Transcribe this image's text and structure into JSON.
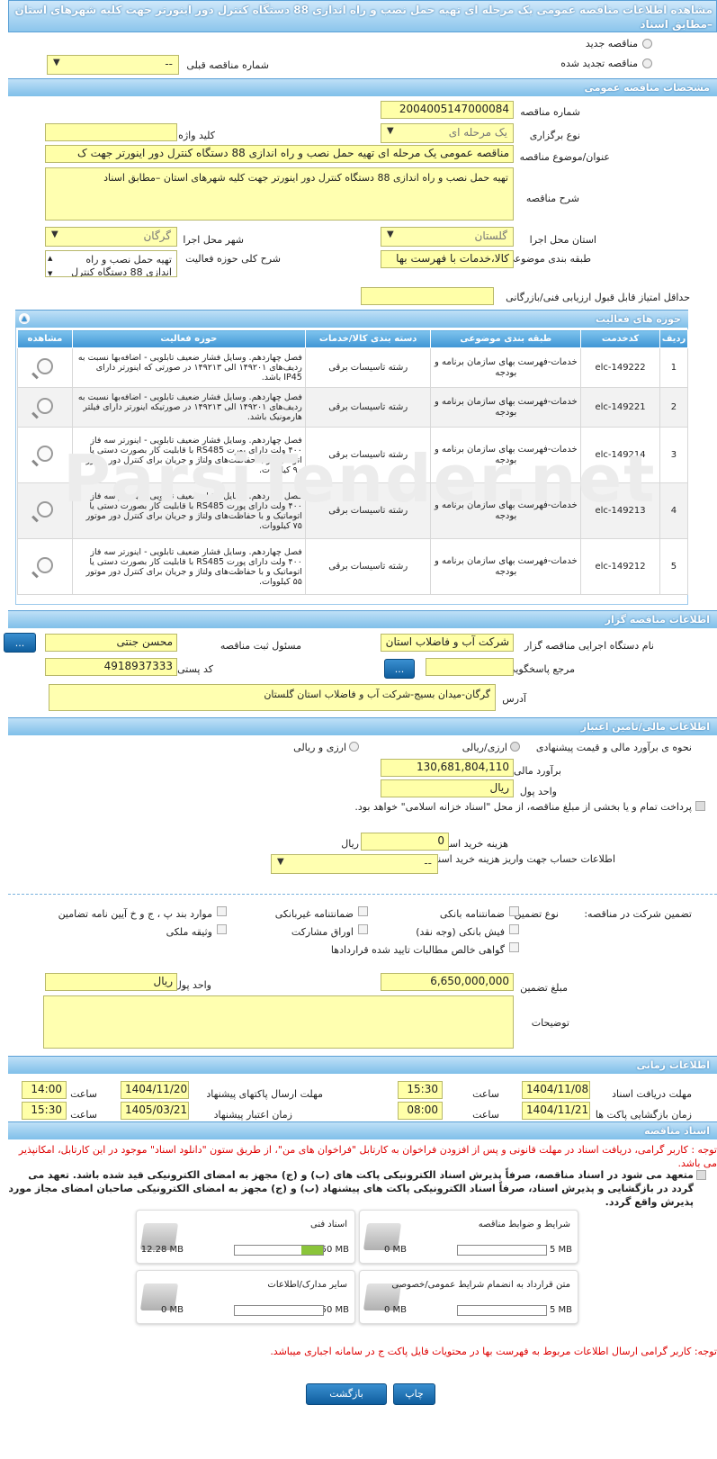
{
  "title": "مشاهده اطلاعات مناقصه عمومی یک مرحله ای تهیه حمل نصب و راه اندازی 88 دستگاه کنترل دور اینورتر جهت کلیه شهرهای استان –مطابق اسناد",
  "type_new": "مناقصه جدید",
  "type_renew": "مناقصه تجدید شده",
  "prev_label": "شماره مناقصه قبلی",
  "prev_value": "--",
  "sec_general": "مشخصات مناقصه عمومی",
  "tender_no_label": "شماره مناقصه",
  "tender_no": "2004005147000084",
  "hold_type_label": "نوع برگزاری",
  "hold_type": "یک مرحله ای",
  "keyword_label": "کلید واژه",
  "subject_label": "عنوان/موضوع مناقصه",
  "subject": "مناقصه عمومی یک مرحله ای تهیه حمل نصب و راه اندازی 88 دستگاه کنترل دور اینورتر جهت ک",
  "desc_label": "شرح مناقصه",
  "desc": "تهیه حمل نصب و راه اندازی 88 دستگاه کنترل دور اینورتر جهت کلیه شهرهای استان –مطابق اسناد",
  "province_label": "استان محل اجرا",
  "province": "گلستان",
  "city_label": "شهر محل اجرا",
  "city": "گرگان",
  "class_label": "طبقه بندی موضوعی",
  "class_value": "کالا،خدمات با فهرست بها",
  "activity_desc_label": "شرح کلی حوزه فعالیت",
  "activity_desc": "تهیه حمل نصب و راه اندازی 88 دستگاه کنترل",
  "min_score_label": "حداقل امتیاز قابل قبول ارزیابی فنی/بازرگانی",
  "sec_activity": "حوزه های فعالیت",
  "table_headers": [
    "ردیف",
    "کدخدمت",
    "طبقه بندی موضوعی",
    "دسته بندی کالا/خدمات",
    "حوزه فعالیت",
    "مشاهده"
  ],
  "table_rows": [
    {
      "no": "1",
      "code": "elc-149222",
      "class": "خدمات-فهرست بهای سازمان برنامه و بودجه",
      "cat": "رشته تاسیسات برقی",
      "act": "فصل چهاردهم. وسایل فشار ضعیف تابلویی - اضافه‌بها نسبت به ردیف‌های ۱۴۹۲۰۱ الی ۱۴۹۲۱۳ در صورتی که اینورتر دارای IP45 باشد."
    },
    {
      "no": "2",
      "code": "elc-149221",
      "class": "خدمات-فهرست بهای سازمان برنامه و بودجه",
      "cat": "رشته تاسیسات برقی",
      "act": "فصل چهاردهم. وسایل فشار ضعیف تابلویی - اضافه‌بها نسبت به ردیف‌های ۱۴۹۲۰۱ الی ۱۴۹۲۱۳ در صورتیکه اینورتر دارای فیلتر هارمونیک باشد."
    },
    {
      "no": "3",
      "code": "elc-149214",
      "class": "خدمات-فهرست بهای سازمان برنامه و بودجه",
      "cat": "رشته تاسیسات برقی",
      "act": "فصل چهاردهم. وسایل فشار ضعیف تابلویی - اینورتر سه فاز ۴۰۰ ولت دارای پورت RS485 با قابلیت کار بصورت دستی یا اتوماتیک و با حفاظت‌های ولتاژ و جریان برای کنترل دور موتور ۹۰ کیلووات."
    },
    {
      "no": "4",
      "code": "elc-149213",
      "class": "خدمات-فهرست بهای سازمان برنامه و بودجه",
      "cat": "رشته تاسیسات برقی",
      "act": "فصل چهاردهم. وسایل فشار ضعیف تابلویی - اینورتر سه فاز ۴۰۰ ولت دارای پورت RS485 با قابلیت کار بصورت دستی یا اتوماتیک و با حفاظت‌های ولتاژ و جریان برای کنترل دور موتور ۷۵ کیلووات."
    },
    {
      "no": "5",
      "code": "elc-149212",
      "class": "خدمات-فهرست بهای سازمان برنامه و بودجه",
      "cat": "رشته تاسیسات برقی",
      "act": "فصل چهاردهم. وسایل فشار ضعیف تابلویی - اینورتر سه فاز ۴۰۰ ولت دارای پورت RS485 با قابلیت کار بصورت دستی یا اتوماتیک و با حفاظت‌های ولتاژ و جریان برای کنترل دور موتور ۵۵ کیلووات."
    }
  ],
  "watermark": "ParsiTender.net",
  "sec_organizer": "اطلاعات مناقصه گزار",
  "org_label": "نام دستگاه اجرایی مناقصه گزار",
  "org": "شرکت آب و فاضلاب استان",
  "resp_label": "مسئول ثبت مناقصه",
  "resp": "محسن جنتی",
  "ref_label": "مرجع پاسخگویی",
  "postal_label": "کد پستی",
  "postal": "4918937333",
  "address_label": "آدرس",
  "address": "گرگان-میدان بسیج-شرکت آب و فاضلاب استان گلستان",
  "dots": "...",
  "sec_finance": "اطلاعات مالی/تامین اعتبار",
  "estimate_type_label": "نحوه ی برآورد مالی و قیمت پیشنهادی",
  "opt_rial": "ارزی/ریالی",
  "opt_both": "ارزی و ریالی",
  "estimate_label": "برآورد مالی",
  "estimate": "130,681,804,110",
  "currency_label": "واحد پول",
  "currency": "ریال",
  "treasury_text": "پرداخت تمام و یا بخشی از مبلغ مناقصه، از محل \"اسناد خزانه اسلامی\" خواهد بود.",
  "doc_cost_label": "هزینه خرید اسناد",
  "doc_cost": "0",
  "doc_cost_unit": "ریال",
  "account_label": "اطلاعات حساب جهت واریز هزینه خرید اسناد",
  "account_value": "--",
  "guarantee_label": "تضمین شرکت در مناقصه:",
  "guarantee_type_label": "نوع تضمین",
  "g1": "ضمانتنامه بانکی",
  "g2": "ضمانتنامه غیربانکی",
  "g3": "موارد بند پ ، ج و خ آیین نامه تضامین",
  "g4": "فیش بانکی (وجه نقد)",
  "g5": "اوراق مشارکت",
  "g6": "وثیقه ملکی",
  "g7": "گواهی خالص مطالبات تایید شده قراردادها",
  "guarantee_amount_label": "مبلغ تضمین",
  "guarantee_amount": "6,650,000,000",
  "g_currency_label": "واحد پول",
  "g_currency": "ریال",
  "notes_label": "توضیحات",
  "sec_time": "اطلاعات زمانی",
  "doc_deadline_label": "مهلت دریافت اسناد",
  "doc_deadline": "1404/11/08",
  "time_label": "ساعت",
  "doc_deadline_time": "15:30",
  "send_deadline_label": "مهلت ارسال پاکتهای پیشنهاد",
  "send_deadline": "1404/11/20",
  "send_deadline_time": "14:00",
  "open_label": "زمان بازگشایی پاکت ها",
  "open_date": "1404/11/21",
  "open_time": "08:00",
  "valid_label": "زمان اعتبار پیشنهاد",
  "valid_date": "1405/03/21",
  "valid_time": "15:30",
  "sec_docs": "اسناد مناقصه",
  "notice1": "توجه : کاربر گرامی، دریافت اسناد در مهلت قانونی و پس از افزودن فراخوان به کارتابل \"فراخوان های من\"، از طریق ستون \"دانلود اسناد\" موجود در این کارتابل، امکانپذیر می باشد.",
  "commit": "متعهد می شود در اسناد مناقصه، صرفاً پذیرش اسناد الکترونیکی پاکت های (ب) و (ج) مجهز به امضای الکترونیکی قید شده باشد. تعهد می گردد در بازگشایی و پذیرش اسناد، صرفاً اسناد الکترونیکی پاکت های پیشنهاد (ب) و (ج) مجهز به امضای الکترونیکی صاحبان امضای مجاز مورد پذیرش واقع گردد.",
  "files": [
    {
      "name": "شرایط و ضوابط مناقصه",
      "used": "0 MB",
      "max": "5 MB",
      "fill": 0
    },
    {
      "name": "اسناد فنی",
      "used": "12.28 MB",
      "max": "50 MB",
      "fill": 0.2456
    },
    {
      "name": "متن قرارداد به انضمام شرایط عمومی/خصوصی",
      "used": "0 MB",
      "max": "5 MB",
      "fill": 0
    },
    {
      "name": "سایر مدارک/اطلاعات",
      "used": "0 MB",
      "max": "50 MB",
      "fill": 0
    }
  ],
  "notice2": "توجه: کاربر گرامی ارسال اطلاعات مربوط به فهرست بها در محتویات فایل پاکت ج در سامانه اجباری میباشد.",
  "print_btn": "چاپ",
  "back_btn": "بازگشت"
}
